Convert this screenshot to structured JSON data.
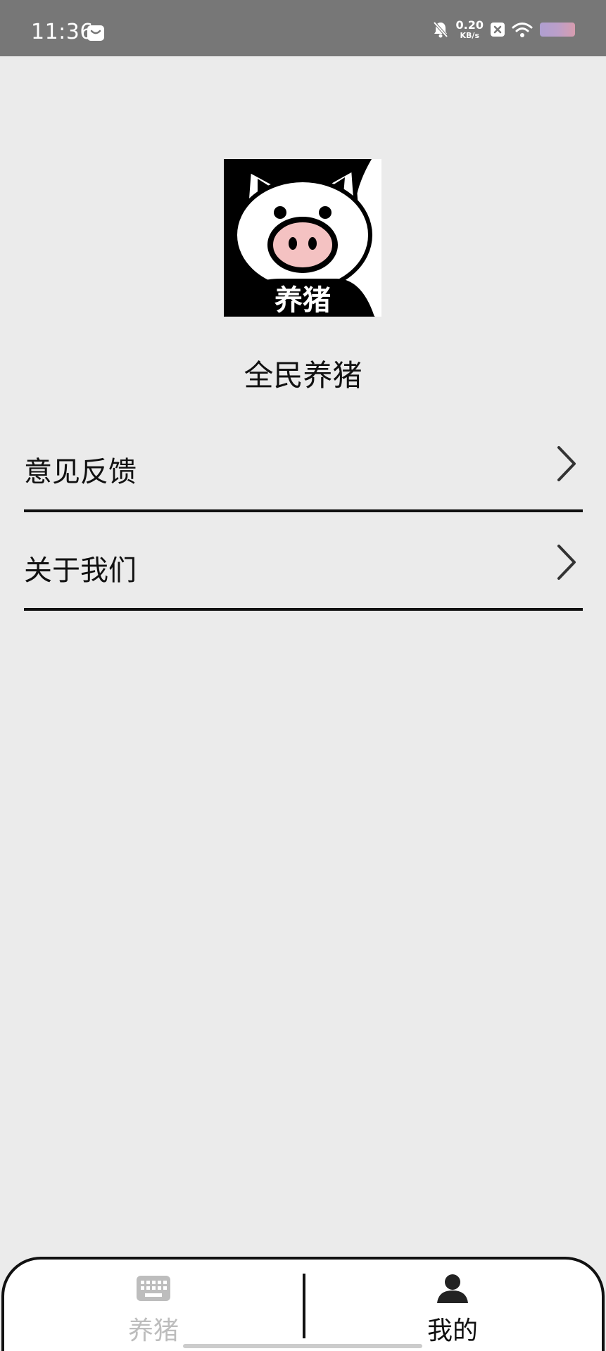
{
  "status_bar": {
    "time": "11:36",
    "net_speed_value": "0.20",
    "net_speed_unit": "KB/s",
    "icons": [
      "message-icon",
      "mute-bell-icon",
      "close-box-icon",
      "wifi-icon",
      "battery-icon"
    ]
  },
  "app": {
    "logo_text": "养猪",
    "name": "全民养猪"
  },
  "menu": {
    "items": [
      {
        "label": "意见反馈",
        "icon": "chevron-right-icon"
      },
      {
        "label": "关于我们",
        "icon": "chevron-right-icon"
      }
    ]
  },
  "tabbar": {
    "tabs": [
      {
        "label": "养猪",
        "icon": "keyboard-icon",
        "active": false
      },
      {
        "label": "我的",
        "icon": "person-icon",
        "active": true
      }
    ]
  },
  "colors": {
    "background": "#ebebeb",
    "status_bar": "#777777",
    "text": "#111111",
    "inactive_tab": "#bdbdbd",
    "pig_nose": "#f4c2c2"
  }
}
